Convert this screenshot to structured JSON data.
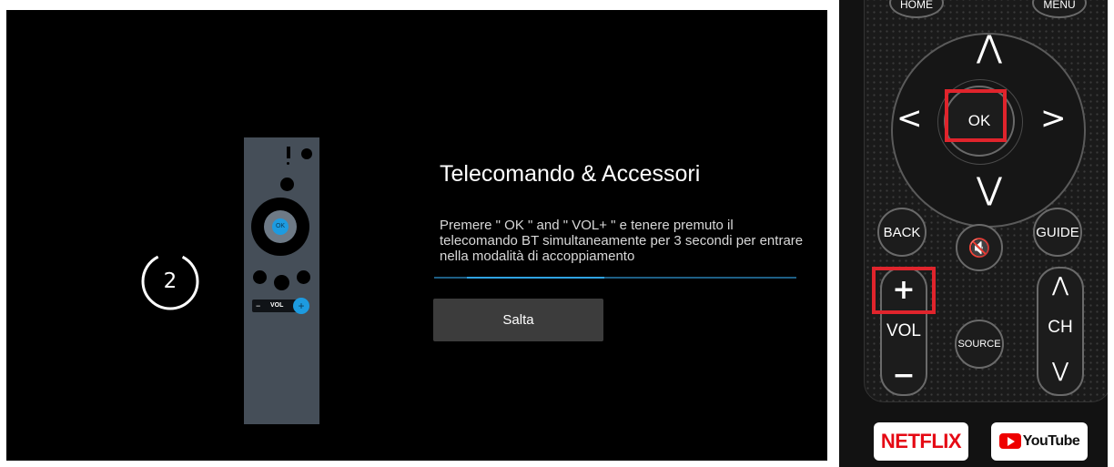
{
  "tv_screen": {
    "countdown": {
      "value": "2",
      "remaining_fraction": 0.85
    },
    "mini_remote": {
      "ok_label": "OK",
      "vol_label": "VOL",
      "vol_minus": "−",
      "vol_plus": "+"
    },
    "title": "Telecomando & Accessori",
    "instructions": "Premere \" OK \" and \" VOL+ \" e tenere premuto il telecomando BT simultaneamente per 3 secondi per entrare nella modalità di accoppiamento",
    "progress_fraction": 0.38,
    "skip_button_label": "Salta",
    "colors": {
      "background": "#000000",
      "accent": "#2fa3e3",
      "remote_body": "#454e58",
      "button": "#3c3c3c"
    }
  },
  "physical_remote": {
    "top_left_partial": "HOME",
    "top_right_partial": "MENU",
    "up_arrow": "⋀",
    "left_arrow": "<",
    "ok_label": "OK",
    "right_arrow": ">",
    "down_arrow": "⋁",
    "back_label": "BACK",
    "guide_label": "GUIDE",
    "mute_icon": "🔇",
    "vol_plus": "+",
    "vol_label": "VOL",
    "vol_minus": "−",
    "source_label": "SOURCE",
    "ch_up": "⋀",
    "ch_label": "CH",
    "ch_down": "⋁",
    "netflix_label": "NETFLIX",
    "youtube_label": "YouTube",
    "highlight_color": "#e0242c",
    "highlighted_buttons": [
      "OK",
      "VOL+"
    ]
  }
}
